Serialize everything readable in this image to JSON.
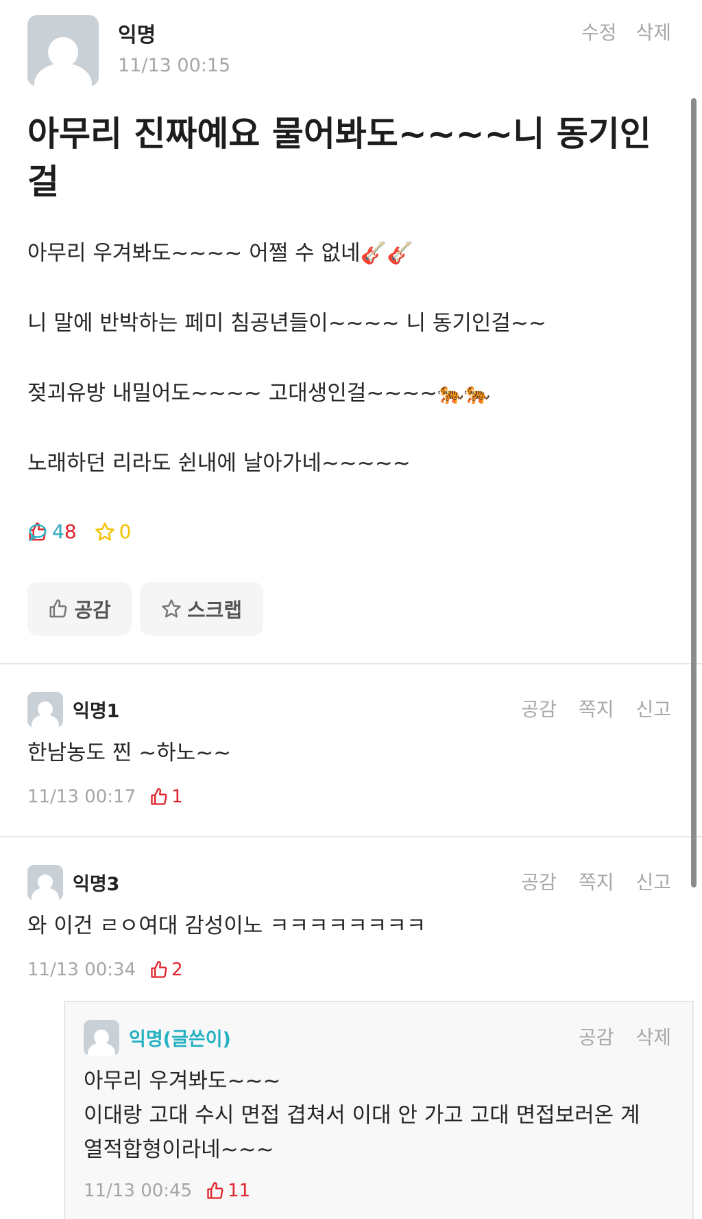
{
  "post": {
    "author": "익명",
    "time": "11/13 00:15",
    "actions": [
      "수정",
      "삭제"
    ],
    "title": "아무리 진짜예요 물어봐도~~~~니 동기인걸",
    "body": [
      "아무리 우겨봐도~~~~ 어쩔 수 없네🎸🎸",
      "니 말에 반박하는 페미 침공년들이~~~~ 니 동기인걸~~",
      "젖괴유방 내밀어도~~~~ 고대생인걸~~~~🐅🐅",
      "노래하던 리라도 쉰내에 날아가네~~~~~"
    ],
    "stats": {
      "likes": "48",
      "comments": "4",
      "scraps": "0"
    },
    "buttons": {
      "like": "공감",
      "scrap": "스크랩"
    }
  },
  "comments": [
    {
      "author": "익명1",
      "actions": [
        "공감",
        "쪽지",
        "신고"
      ],
      "text": "한남농도 찐 ~하노~~",
      "time": "11/13 00:17",
      "likes": "1"
    },
    {
      "author": "익명3",
      "actions": [
        "공감",
        "쪽지",
        "신고"
      ],
      "text": "와 이건 ㄹㅇ여대 감성이노 ㅋㅋㅋㅋㅋㅋㅋㅋ",
      "time": "11/13 00:34",
      "likes": "2"
    }
  ],
  "reply": {
    "author": "익명(글쓴이)",
    "actions": [
      "공감",
      "삭제"
    ],
    "lines": [
      "아무리 우겨봐도~~~",
      "이대랑 고대 수시 면접 겹쳐서 이대 안 가고 고대 면접보러온 계",
      "열적합형이라네~~~"
    ],
    "time": "11/13 00:45",
    "likes": "11"
  },
  "colors": {
    "like": "#e0242b",
    "comment": "#2ab3c5",
    "scrap": "#f2c200",
    "author_reply": "#23b0c3"
  },
  "icons": [
    "avatar-icon",
    "thumbs-up-icon",
    "speech-bubble-icon",
    "star-icon"
  ]
}
